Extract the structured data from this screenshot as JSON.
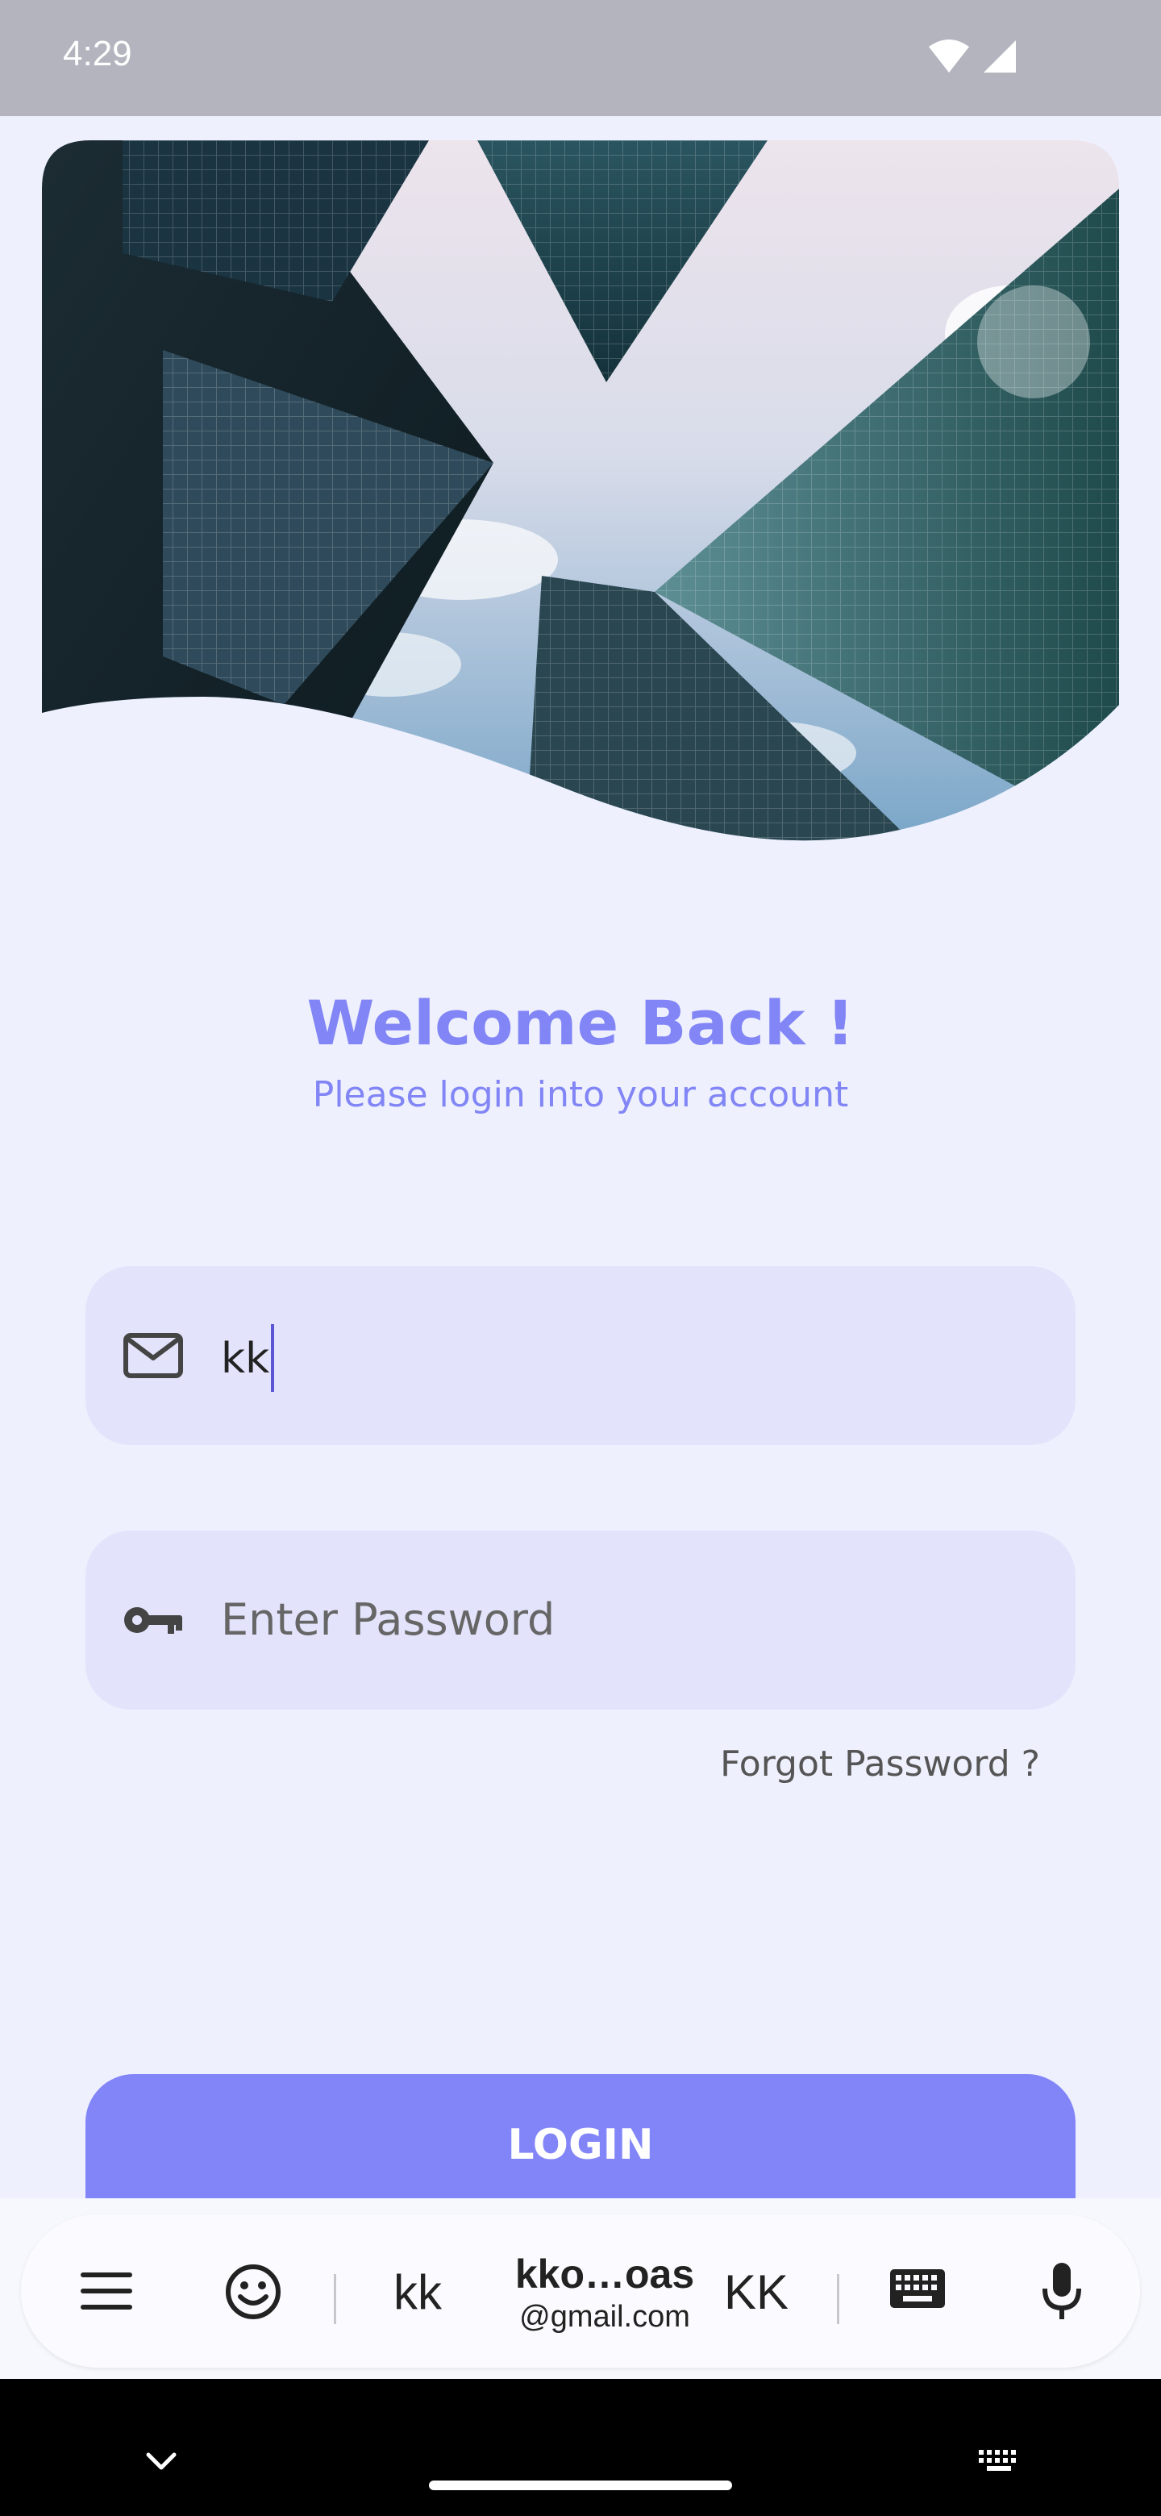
{
  "status_bar": {
    "time": "4:29",
    "wifi_icon": "wifi-icon",
    "signal_icon": "signal-icon"
  },
  "hero": {
    "image_icon": "skyscrapers-image"
  },
  "login": {
    "title": "Welcome Back !",
    "subtitle": "Please login into your account",
    "email": {
      "icon": "mail-icon",
      "value": "kk"
    },
    "password": {
      "icon": "key-icon",
      "placeholder": "Enter Password"
    },
    "forgot_label": "Forgot Password ?",
    "login_label": "LOGIN",
    "accent_color": "#8185f5"
  },
  "keyboard": {
    "menu_icon": "menu-icon",
    "emoji_icon": "emoji-icon",
    "suggestion_left": "kk",
    "suggestion_center_line1": "kko…oas",
    "suggestion_center_line2": "@gmail.com",
    "suggestion_right": "KK",
    "keyboard_icon": "keyboard-icon",
    "mic_icon": "mic-icon"
  },
  "nav_bar": {
    "back_icon": "chevron-down-icon",
    "switch_keyboard_icon": "keyboard-switch-icon"
  }
}
